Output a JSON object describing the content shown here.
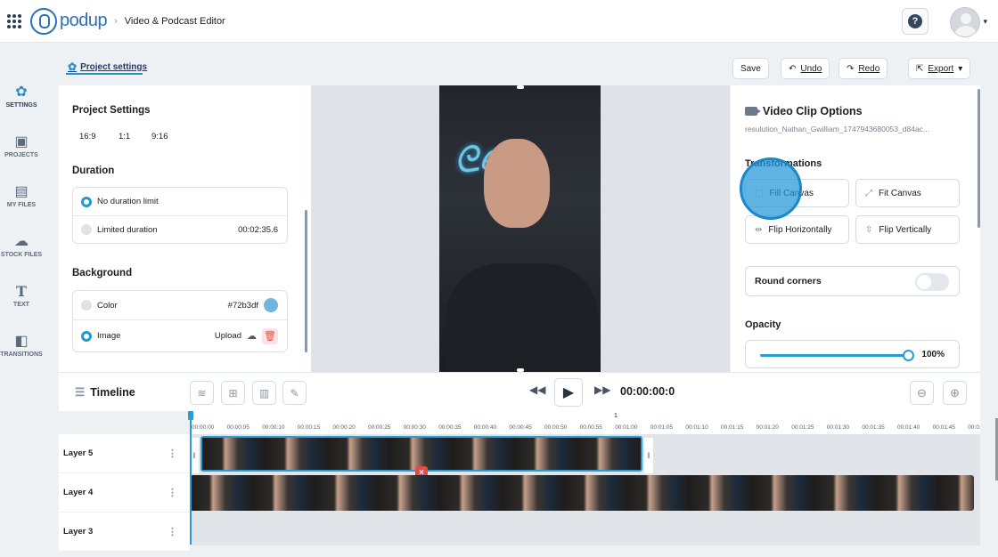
{
  "topbar": {
    "logo_text": "podup",
    "breadcrumb": "Video & Podcast Editor",
    "help": "?"
  },
  "nav": [
    {
      "label": "SETTINGS",
      "icon": "gear-icon"
    },
    {
      "label": "PROJECTS",
      "icon": "projects-icon"
    },
    {
      "label": "MY FILES",
      "icon": "files-icon"
    },
    {
      "label": "STOCK FILES",
      "icon": "cloud-icon"
    },
    {
      "label": "TEXT",
      "icon": "text-icon"
    },
    {
      "label": "TRANSITIONS",
      "icon": "transitions-icon"
    }
  ],
  "header": {
    "project_settings": "Project settings",
    "save": "Save",
    "undo": "Undo",
    "redo": "Redo",
    "export": "Export"
  },
  "project": {
    "title": "Project Settings",
    "ratios": [
      "16:9",
      "1:1",
      "9:16"
    ],
    "duration_title": "Duration",
    "no_limit": "No duration limit",
    "limited": "Limited duration",
    "limited_value": "00:02:35.6",
    "background_title": "Background",
    "color_label": "Color",
    "color_value": "#72b3df",
    "image_label": "Image",
    "upload": "Upload"
  },
  "clip": {
    "title": "Video Clip Options",
    "filename": "resulution_Nathan_Gwilliam_1747943680053_d84ac...",
    "transformations": "Transformations",
    "fill_canvas": "Fill Canvas",
    "fit_canvas": "Fit Canvas",
    "flip_h": "Flip Horizontally",
    "flip_v": "Flip Vertically",
    "round_corners": "Round corners",
    "opacity_title": "Opacity",
    "opacity_value": "100%",
    "opacity_fraction": 1.0
  },
  "timeline": {
    "title": "Timeline",
    "timecode": "00:00:00:0",
    "minute_label": "1",
    "ticks": [
      "00:00:00",
      "00:00:05",
      "00:00:10",
      "00:00:15",
      "00:00:20",
      "00:00:25",
      "00:00:30",
      "00:00:35",
      "00:00:40",
      "00:00:45",
      "00:00:50",
      "00:00:55",
      "00:01:00",
      "00:01:05",
      "00:01:10",
      "00:01:15",
      "00:01:20",
      "00:01:25",
      "00:01:30",
      "00:01:35",
      "00:01:40",
      "00:01:45",
      "00:01:50"
    ],
    "layers": [
      "Layer 5",
      "Layer 4",
      "Layer 3"
    ]
  }
}
